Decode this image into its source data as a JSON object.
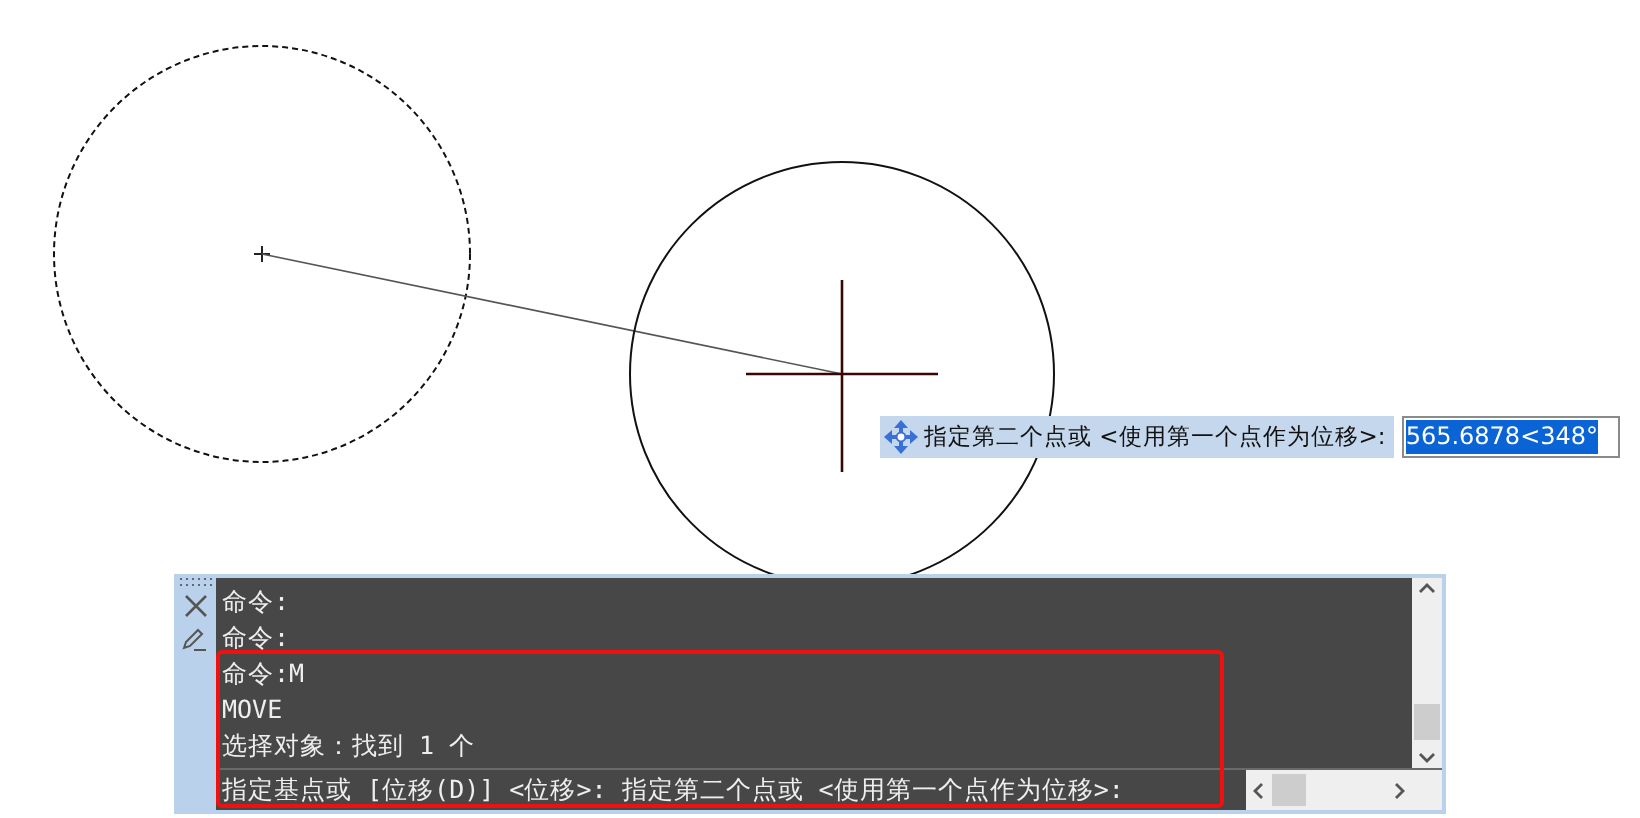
{
  "canvas": {
    "tooltip": {
      "prompt": "指定第二个点或 <使用第一个点作为位移>:",
      "value": "565.6878<348°"
    }
  },
  "command_panel": {
    "history": [
      "命令:",
      "命令:",
      "命令:M",
      "MOVE",
      "选择对象：找到 1 个"
    ],
    "command_line": "指定基点或 [位移(D)] <位移>:  指定第二个点或 <使用第一个点作为位移>:",
    "highlight": true
  }
}
